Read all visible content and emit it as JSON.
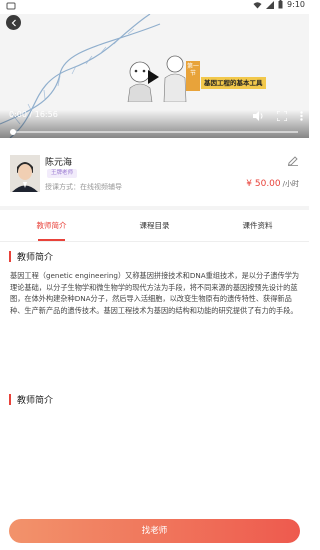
{
  "status_bar": {
    "time": "9:10"
  },
  "video": {
    "slide_badge": "第一节",
    "slide_title": "基因工程的基本工具",
    "time_text": "0:00 / 16:56",
    "progress": 0.0
  },
  "teacher": {
    "name": "陈元海",
    "tag": "王牌老师",
    "method": "授课方式：在线视频辅导",
    "price": "¥ 50.00",
    "price_unit": "/小时"
  },
  "tabs": [
    {
      "label": "教师简介",
      "active": true
    },
    {
      "label": "课程目录",
      "active": false
    },
    {
      "label": "课件资料",
      "active": false
    }
  ],
  "section1": {
    "title": "教师简介",
    "body": "基因工程（genetic engineering）又称基因拼接技术和DNA重组技术，是以分子遗传学为理论基础，以分子生物学和微生物学的现代方法为手段，将不同来源的基因按预先设计的蓝图，在体外构建杂种DNA分子，然后导入活细胞，以改变生物原有的遗传特性、获得新品种、生产新产品的遗传技术。基因工程技术为基因的结构和功能的研究提供了有力的手段。"
  },
  "section2": {
    "title": "教师简介"
  },
  "cta": {
    "label": "找老师"
  },
  "colors": {
    "accent": "#e8423a",
    "tag_bg": "#f2ecfb",
    "tag_text": "#9a7ad1"
  },
  "icons": [
    "back-icon",
    "play-icon",
    "volume-icon",
    "fullscreen-icon",
    "more-icon",
    "edit-icon",
    "wifi-icon",
    "signal-icon",
    "battery-icon"
  ]
}
